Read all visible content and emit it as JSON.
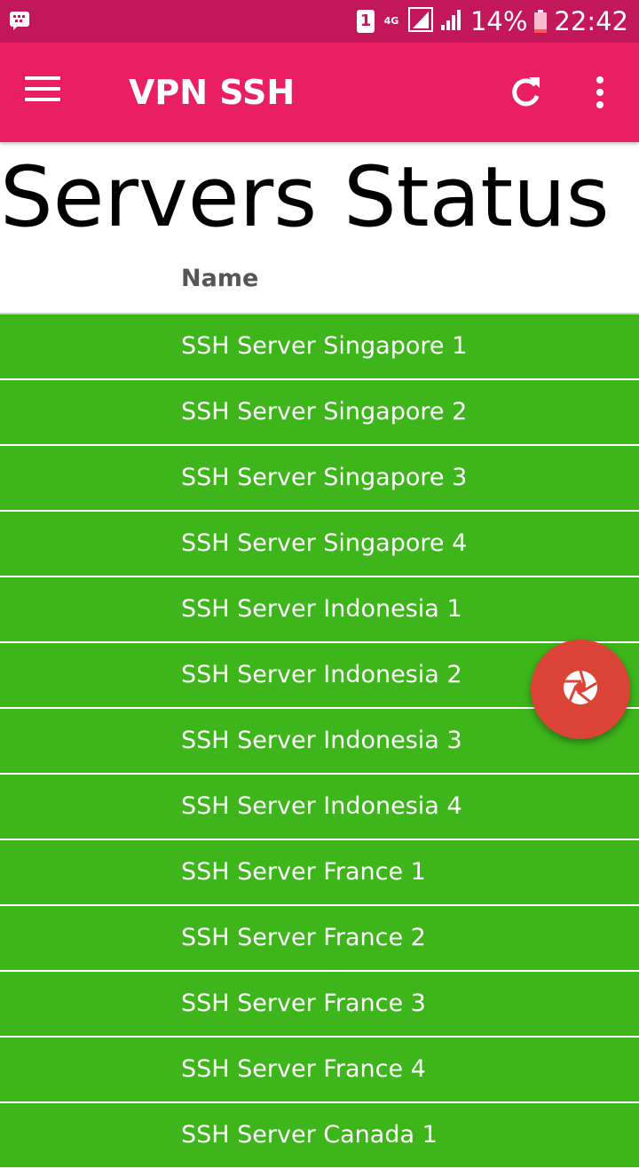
{
  "status_bar": {
    "sim_label": "1",
    "network_label": "4G",
    "battery": "14%",
    "time": "22:42"
  },
  "app_bar": {
    "title": "VPN SSH"
  },
  "page": {
    "title": "Servers Status",
    "column_header": "Name"
  },
  "servers": [
    "SSH Server Singapore 1",
    "SSH Server Singapore 2",
    "SSH Server Singapore 3",
    "SSH Server Singapore 4",
    "SSH Server Indonesia 1",
    "SSH Server Indonesia 2",
    "SSH Server Indonesia 3",
    "SSH Server Indonesia 4",
    "SSH Server France 1",
    "SSH Server France 2",
    "SSH Server France 3",
    "SSH Server France 4",
    "SSH Server Canada 1"
  ],
  "colors": {
    "status_bar": "#c2185b",
    "app_bar": "#e91e63",
    "row_online": "#3db51b",
    "fab": "#db4437"
  },
  "icons": {
    "menu": "hamburger-menu-icon",
    "refresh": "refresh-icon",
    "more": "more-vert-icon",
    "fab": "camera-shutter-icon"
  }
}
